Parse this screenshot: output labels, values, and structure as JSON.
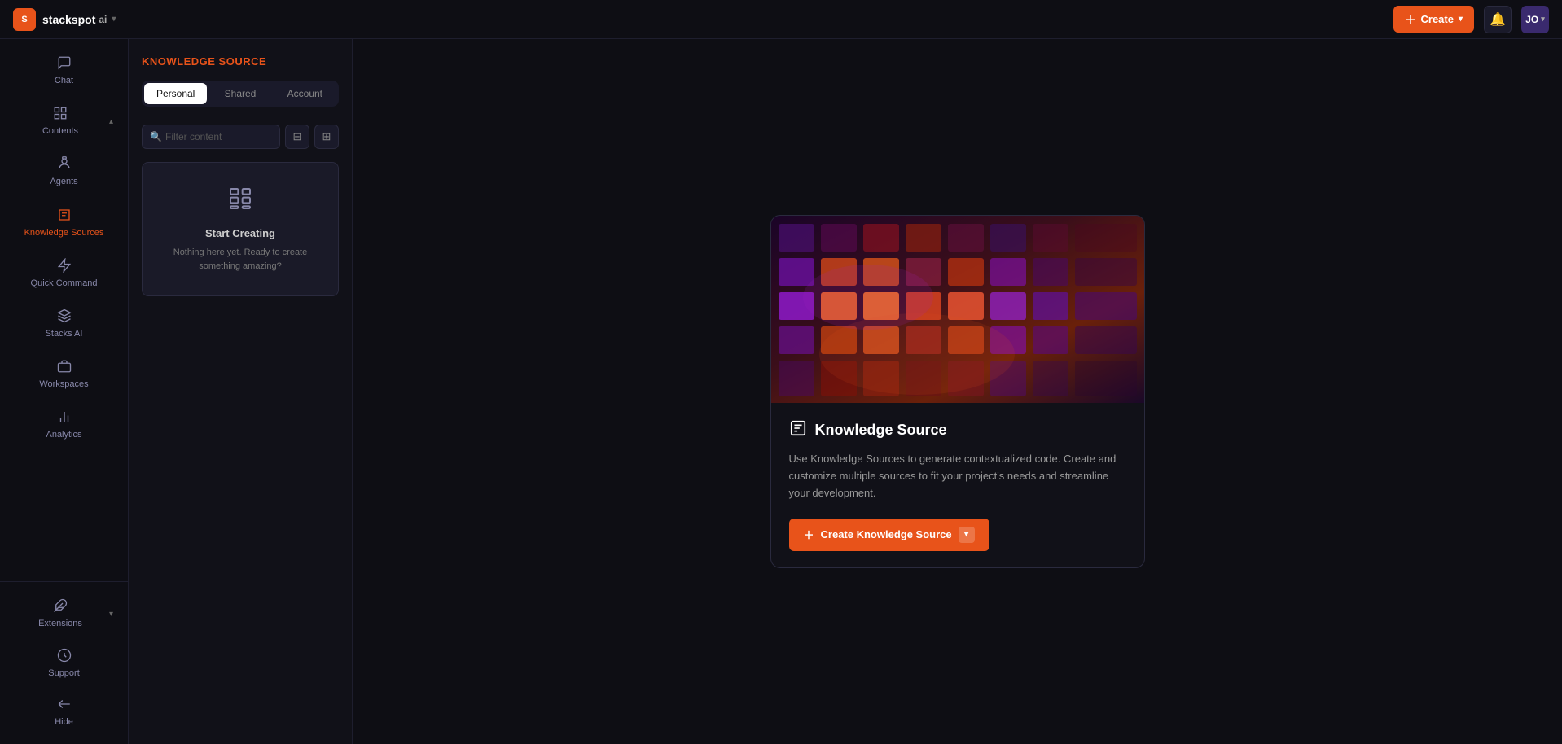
{
  "header": {
    "logo_text": "stackspot",
    "logo_ai": "ai",
    "create_label": "Create",
    "avatar_initials": "JO"
  },
  "sidebar": {
    "items": [
      {
        "id": "chat",
        "label": "Chat",
        "icon": "💬"
      },
      {
        "id": "contents",
        "label": "Contents",
        "icon": "⊞",
        "collapsible": true
      },
      {
        "id": "agents",
        "label": "Agents",
        "icon": "🤖"
      },
      {
        "id": "knowledge-sources",
        "label": "Knowledge Sources",
        "icon": "📚",
        "active": true
      },
      {
        "id": "quick-command",
        "label": "Quick Command",
        "icon": "⚡"
      },
      {
        "id": "stacks-ai",
        "label": "Stacks AI",
        "icon": "◈"
      },
      {
        "id": "workspaces",
        "label": "Workspaces",
        "icon": "🗂"
      },
      {
        "id": "analytics",
        "label": "Analytics",
        "icon": "📊"
      }
    ],
    "bottom_items": [
      {
        "id": "extensions",
        "label": "Extensions",
        "icon": "🔌",
        "collapsible": true
      },
      {
        "id": "support",
        "label": "Support",
        "icon": "🔊"
      },
      {
        "id": "hide",
        "label": "Hide",
        "icon": "⇤"
      }
    ]
  },
  "left_panel": {
    "title": "KNOWLEDGE SOURCE",
    "tabs": [
      {
        "id": "personal",
        "label": "Personal",
        "active": true
      },
      {
        "id": "shared",
        "label": "Shared",
        "active": false
      },
      {
        "id": "account",
        "label": "Account",
        "active": false
      }
    ],
    "search_placeholder": "Filter content",
    "empty_state": {
      "title": "Start Creating",
      "description": "Nothing here yet. Ready to create something amazing?"
    }
  },
  "right_panel": {
    "card": {
      "title": "Knowledge Source",
      "description": "Use Knowledge Sources to generate contextualized code. Create and customize multiple sources to fit your project's needs and streamline your development.",
      "action_label": "Create Knowledge Source"
    }
  }
}
